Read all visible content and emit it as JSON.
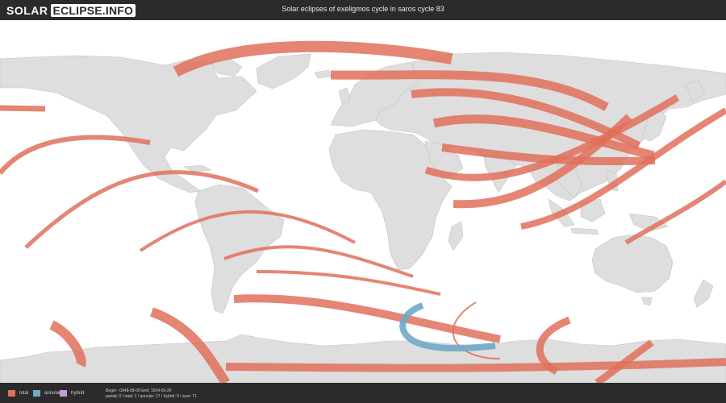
{
  "header": {
    "logo_part1": "SOLAR",
    "logo_part2": "ECLIPSE.INFO",
    "title": "Solar eclipses of exeligmos cycle in saros cycle 83"
  },
  "colors": {
    "header_bg": "#2b2b2b",
    "land": "#dedede",
    "land_border": "#c4c4c4",
    "ocean": "#ffffff",
    "total": "#e0705a",
    "annular": "#6fa8c8",
    "hybrid": "#c79bd6"
  },
  "legend": [
    {
      "label": "total",
      "color": "#e0705a"
    },
    {
      "label": "annular",
      "color": "#6fa8c8"
    },
    {
      "label": "hybrid",
      "color": "#c79bd6"
    }
  ],
  "info": {
    "line1": "Begin: -0048-08-09 End: 1034-05-20",
    "line2": "partial: 0 / total: 1 / annular: 17 / hybrid: 0 / sum: 71"
  }
}
